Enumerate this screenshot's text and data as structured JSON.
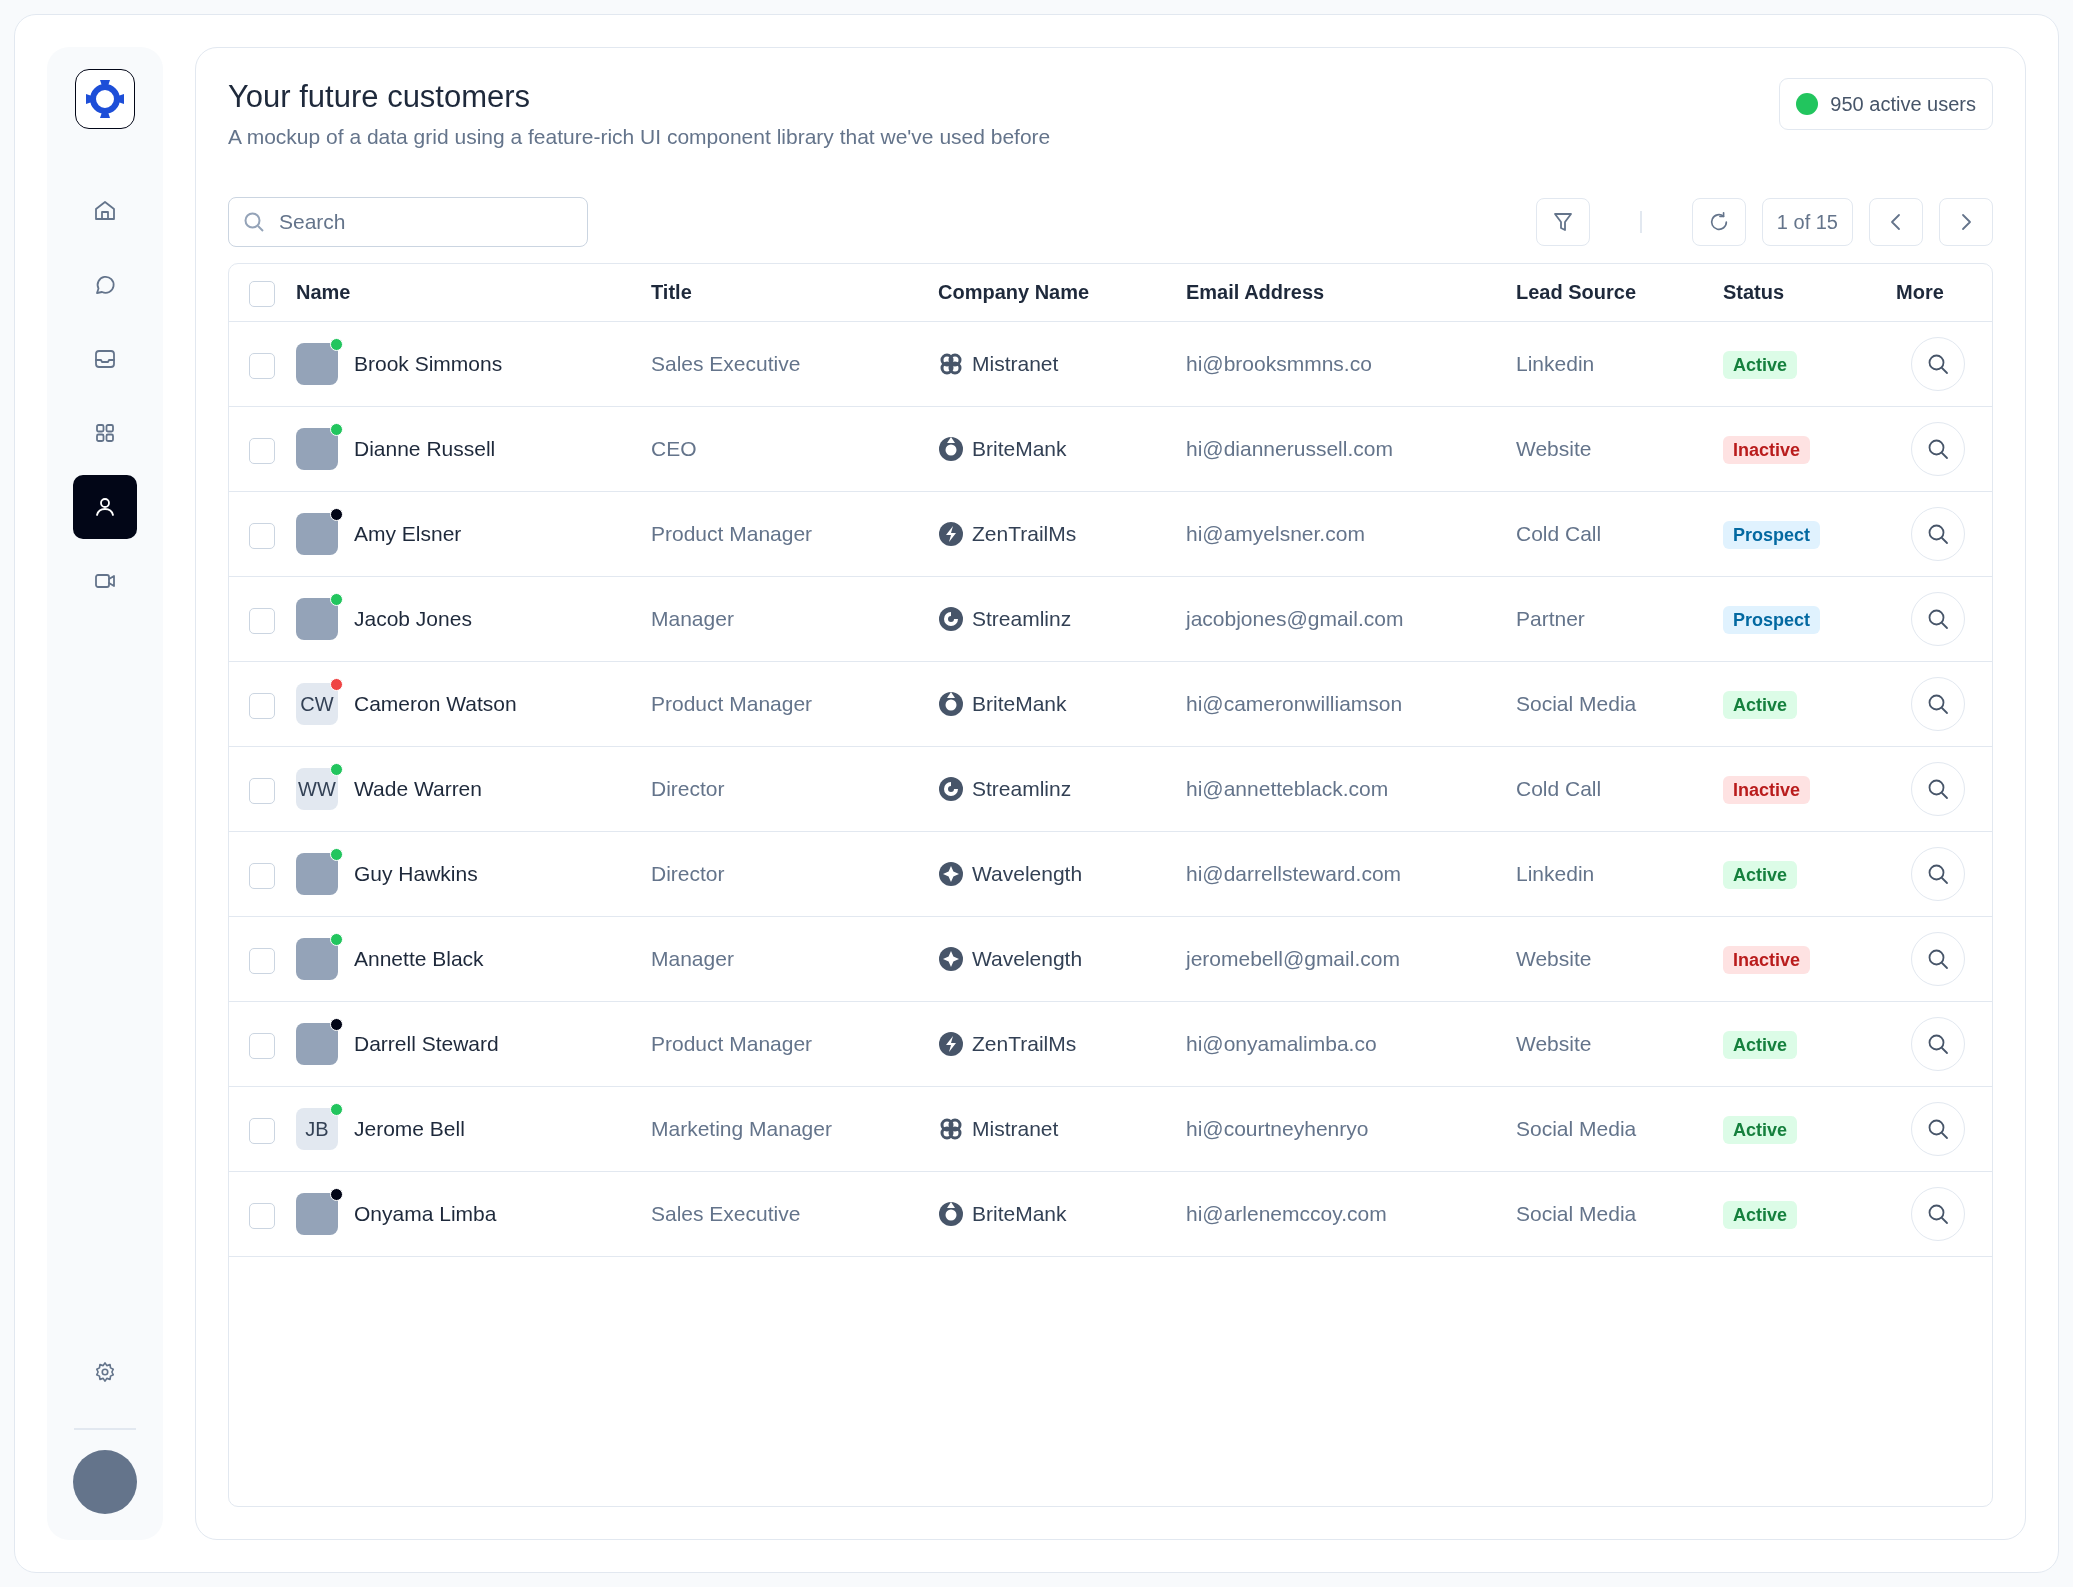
{
  "sidebar": {
    "items": [
      {
        "kind": "home",
        "selected": false
      },
      {
        "kind": "chat",
        "selected": false
      },
      {
        "kind": "inbox",
        "selected": false
      },
      {
        "kind": "grid",
        "selected": false
      },
      {
        "kind": "user",
        "selected": true
      },
      {
        "kind": "video",
        "selected": false
      }
    ]
  },
  "header": {
    "title": "Your future customers",
    "subtitle": "A mockup of a data grid using a feature-rich UI component library that we've used before",
    "active_users": {
      "label": "950 active users",
      "color": "#22c55e"
    }
  },
  "toolbar": {
    "search": {
      "placeholder": "Search"
    },
    "pagination": "1 of 15"
  },
  "table": {
    "select_all": {
      "checked": false
    },
    "columns": [
      "Name",
      "Title",
      "Company Name",
      "Email Address",
      "Lead Source",
      "Status",
      "More"
    ],
    "rows": [
      {
        "checked": false,
        "avatar": {
          "kind": "photo"
        },
        "presence": {
          "color": "#22c55e"
        },
        "name": "Brook Simmons",
        "title": "Sales Executive",
        "company": {
          "name": "Mistranet",
          "kind": "petals"
        },
        "email": "hi@brooksmmns.co",
        "lead_source": "Linkedin",
        "status": {
          "label": "Active",
          "kind": "active"
        }
      },
      {
        "checked": false,
        "avatar": {
          "kind": "photo"
        },
        "presence": {
          "color": "#22c55e"
        },
        "name": "Dianne Russell",
        "title": "CEO",
        "company": {
          "name": "BriteMank",
          "kind": "ring"
        },
        "email": "hi@diannerussell.com",
        "lead_source": "Website",
        "status": {
          "label": "Inactive",
          "kind": "inactive"
        }
      },
      {
        "checked": false,
        "avatar": {
          "kind": "photo"
        },
        "presence": {
          "color": "#020617"
        },
        "name": "Amy Elsner",
        "title": "Product Manager",
        "company": {
          "name": "ZenTrailMs",
          "kind": "bolt"
        },
        "email": "hi@amyelsner.com",
        "lead_source": "Cold Call",
        "status": {
          "label": "Prospect",
          "kind": "prospect"
        }
      },
      {
        "checked": false,
        "avatar": {
          "kind": "photo"
        },
        "presence": {
          "color": "#22c55e"
        },
        "name": "Jacob Jones",
        "title": "Manager",
        "company": {
          "name": "Streamlinz",
          "kind": "swirl"
        },
        "email": "jacobjones@gmail.com",
        "lead_source": "Partner",
        "status": {
          "label": "Prospect",
          "kind": "prospect"
        }
      },
      {
        "checked": false,
        "avatar": {
          "kind": "initials",
          "text": "CW"
        },
        "presence": {
          "color": "#ef4444"
        },
        "name": "Cameron Watson",
        "title": "Product Manager",
        "company": {
          "name": "BriteMank",
          "kind": "ring"
        },
        "email": "hi@cameronwilliamson",
        "lead_source": "Social Media",
        "status": {
          "label": "Active",
          "kind": "active"
        }
      },
      {
        "checked": false,
        "avatar": {
          "kind": "initials",
          "text": "WW"
        },
        "presence": {
          "color": "#22c55e"
        },
        "name": "Wade Warren",
        "title": "Director",
        "company": {
          "name": "Streamlinz",
          "kind": "swirl"
        },
        "email": "hi@annetteblack.com",
        "lead_source": "Cold Call",
        "status": {
          "label": "Inactive",
          "kind": "inactive"
        }
      },
      {
        "checked": false,
        "avatar": {
          "kind": "photo"
        },
        "presence": {
          "color": "#22c55e"
        },
        "name": "Guy Hawkins",
        "title": "Director",
        "company": {
          "name": "Wavelength",
          "kind": "star"
        },
        "email": "hi@darrellsteward.com",
        "lead_source": "Linkedin",
        "status": {
          "label": "Active",
          "kind": "active"
        }
      },
      {
        "checked": false,
        "avatar": {
          "kind": "photo"
        },
        "presence": {
          "color": "#22c55e"
        },
        "name": "Annette Black",
        "title": "Manager",
        "company": {
          "name": "Wavelength",
          "kind": "star"
        },
        "email": "jeromebell@gmail.com",
        "lead_source": "Website",
        "status": {
          "label": "Inactive",
          "kind": "inactive"
        }
      },
      {
        "checked": false,
        "avatar": {
          "kind": "photo"
        },
        "presence": {
          "color": "#020617"
        },
        "name": "Darrell Steward",
        "title": "Product Manager",
        "company": {
          "name": "ZenTrailMs",
          "kind": "bolt"
        },
        "email": "hi@onyamalimba.co",
        "lead_source": "Website",
        "status": {
          "label": "Active",
          "kind": "active"
        }
      },
      {
        "checked": false,
        "avatar": {
          "kind": "initials",
          "text": "JB"
        },
        "presence": {
          "color": "#22c55e"
        },
        "name": "Jerome Bell",
        "title": "Marketing Manager",
        "company": {
          "name": "Mistranet",
          "kind": "petals"
        },
        "email": "hi@courtneyhenryo",
        "lead_source": "Social Media",
        "status": {
          "label": "Active",
          "kind": "active"
        }
      },
      {
        "checked": false,
        "avatar": {
          "kind": "photo"
        },
        "presence": {
          "color": "#020617"
        },
        "name": "Onyama Limba",
        "title": "Sales Executive",
        "company": {
          "name": "BriteMank",
          "kind": "ring"
        },
        "email": "hi@arlenemccoy.com",
        "lead_source": "Social Media",
        "status": {
          "label": "Active",
          "kind": "active"
        }
      }
    ]
  }
}
